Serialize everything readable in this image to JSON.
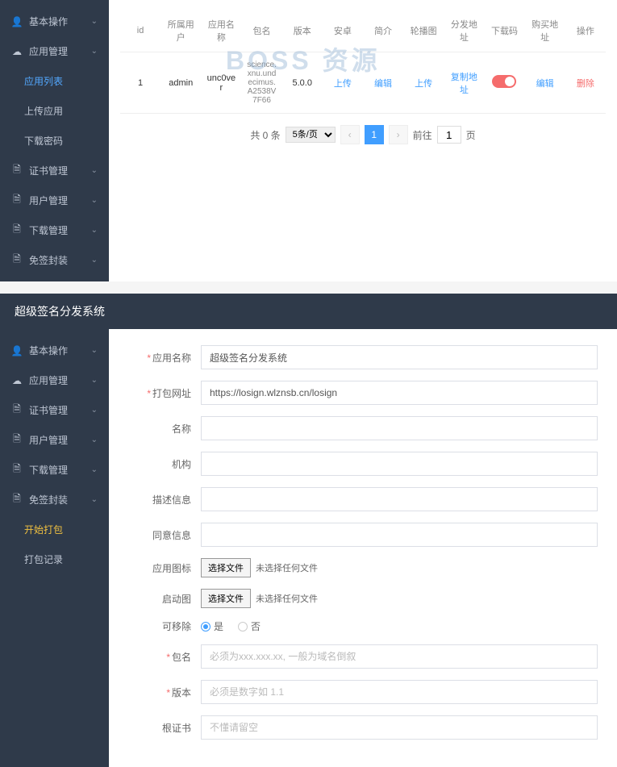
{
  "top": {
    "sidebar": {
      "items": [
        {
          "label": "基本操作",
          "icon": "user-icon",
          "expand": true
        },
        {
          "label": "应用管理",
          "icon": "cloud-icon",
          "expand": true
        },
        {
          "label": "应用列表",
          "icon": "",
          "active": true
        },
        {
          "label": "上传应用",
          "icon": ""
        },
        {
          "label": "下载密码",
          "icon": ""
        },
        {
          "label": "证书管理",
          "icon": "doc-icon",
          "expand": true
        },
        {
          "label": "用户管理",
          "icon": "doc-icon",
          "expand": true
        },
        {
          "label": "下载管理",
          "icon": "doc-icon",
          "expand": true
        },
        {
          "label": "免签封装",
          "icon": "doc-icon",
          "expand": true
        }
      ]
    },
    "table": {
      "headers": [
        "id",
        "所属用户",
        "应用名称",
        "包名",
        "版本",
        "安卓",
        "简介",
        "轮播图",
        "分发地址",
        "下载码",
        "购买地址",
        "操作"
      ],
      "row": {
        "id": "1",
        "user": "admin",
        "appname": "unc0ver",
        "pkg": "science.xnu.undecimus.A2538V7F66",
        "ver": "5.0.0",
        "android_upload": "上传",
        "intro": "编辑",
        "carousel": "上传",
        "dist": "复制地址",
        "buy": "编辑",
        "del": "删除"
      }
    },
    "pager": {
      "total": "共 0 条",
      "size": "5条/页",
      "page": "1",
      "goto": "前往",
      "input": "1",
      "unit": "页"
    },
    "watermark": "BOSS 资源"
  },
  "bottom": {
    "title": "超级签名分发系统",
    "sidebar": {
      "items": [
        {
          "label": "基本操作",
          "icon": "user-icon",
          "expand": true
        },
        {
          "label": "应用管理",
          "icon": "cloud-icon",
          "expand": true
        },
        {
          "label": "证书管理",
          "icon": "doc-icon",
          "expand": true
        },
        {
          "label": "用户管理",
          "icon": "doc-icon",
          "expand": true
        },
        {
          "label": "下载管理",
          "icon": "doc-icon",
          "expand": true
        },
        {
          "label": "免签封装",
          "icon": "doc-icon",
          "expand": true
        },
        {
          "label": "开始打包",
          "icon": "",
          "active2": true
        },
        {
          "label": "打包记录",
          "icon": ""
        }
      ]
    },
    "form": {
      "appname_label": "应用名称",
      "appname_value": "超级签名分发系统",
      "url_label": "打包网址",
      "url_value": "https://losign.wlznsb.cn/losign",
      "name_label": "名称",
      "org_label": "机构",
      "desc_label": "描述信息",
      "consent_label": "同意信息",
      "icon_label": "应用图标",
      "file_btn": "选择文件",
      "file_none": "未选择任何文件",
      "splash_label": "启动图",
      "removable_label": "可移除",
      "radio_yes": "是",
      "radio_no": "否",
      "bundle_label": "包名",
      "bundle_placeholder": "必须为xxx.xxx.xx, 一般为域名倒叙",
      "ver_label": "版本",
      "ver_placeholder": "必须是数字如 1.1",
      "rootcert_label": "根证书",
      "rootcert_placeholder": "不懂请留空"
    }
  }
}
